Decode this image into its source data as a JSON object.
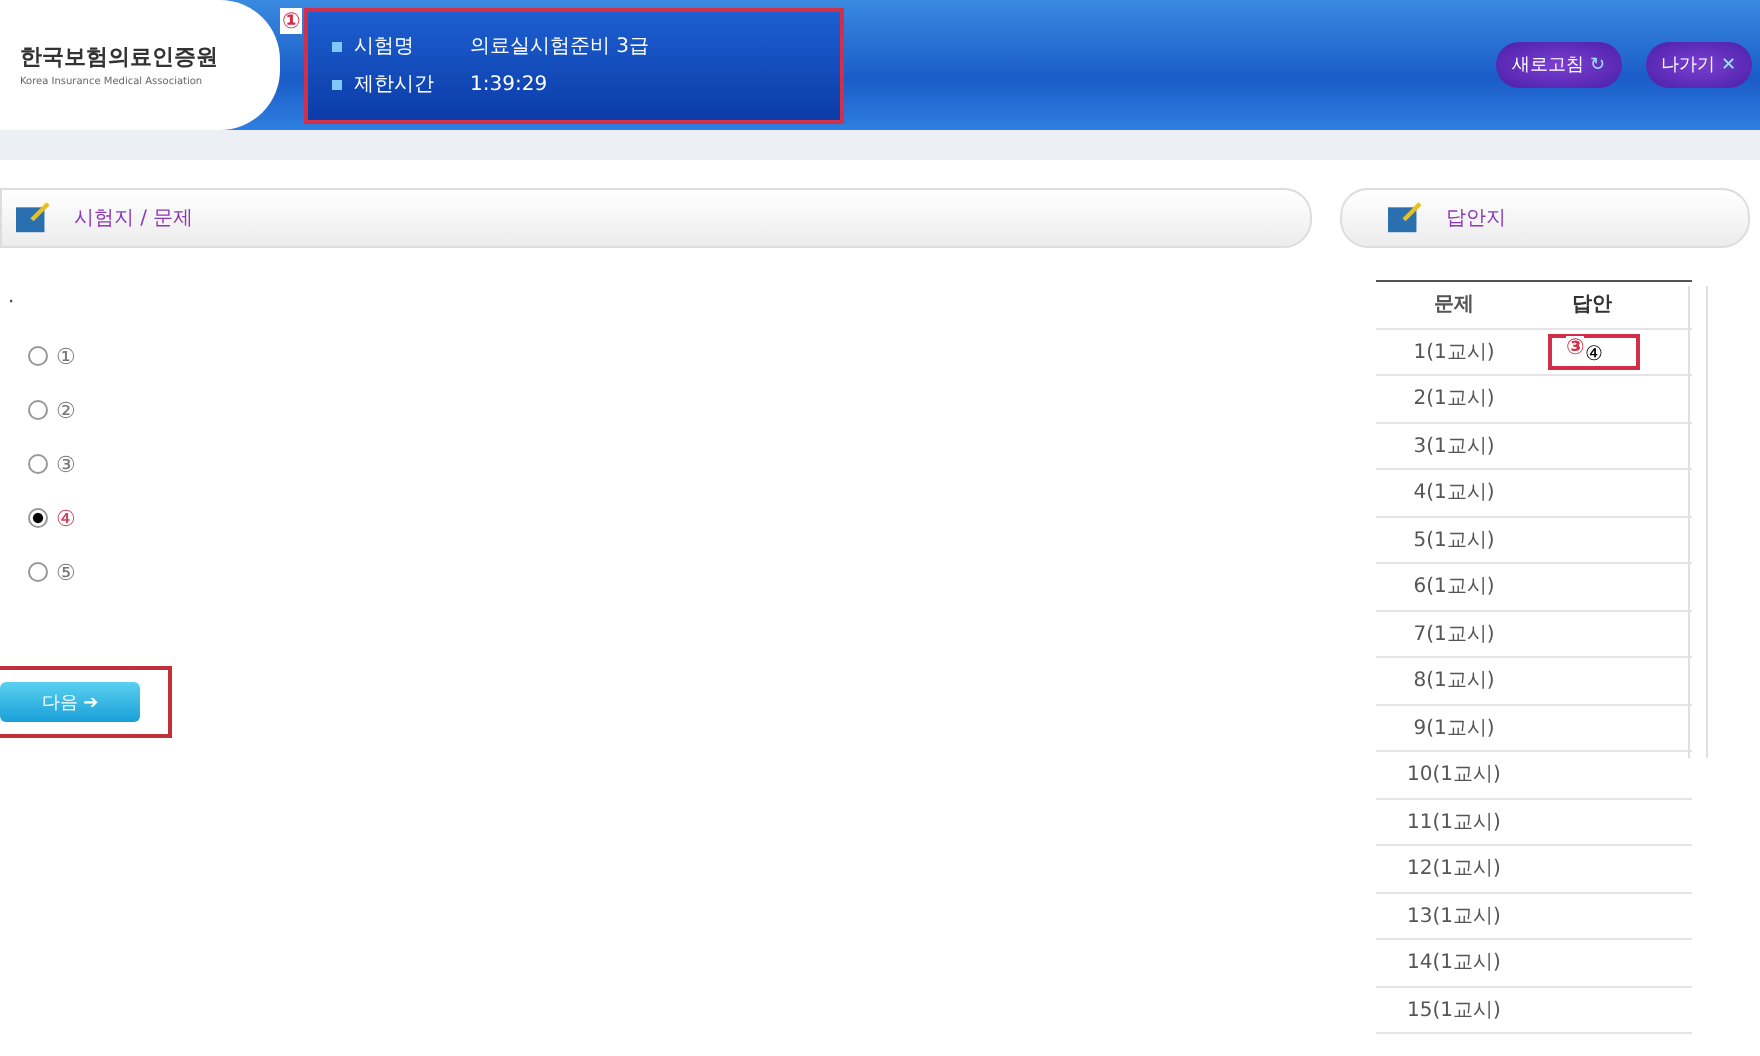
{
  "header": {
    "logo_title": "한국보험의료인증원",
    "logo_subtitle": "Korea Insurance Medical Association",
    "exam_label": "시험명",
    "exam_name": "의료실시험준비 3급",
    "time_label": "제한시간",
    "time_value": "1:39:29",
    "marker": "①",
    "buttons": [
      {
        "label": "새로고침",
        "icon": "↻"
      },
      {
        "label": "나가기",
        "icon": "✕"
      }
    ]
  },
  "question_panel": {
    "title": "시험지 / 문제",
    "question_text": "·",
    "options": [
      {
        "label": "①",
        "selected": false
      },
      {
        "label": "②",
        "selected": false
      },
      {
        "label": "③",
        "selected": false
      },
      {
        "label": "④",
        "selected": true
      },
      {
        "label": "⑤",
        "selected": false
      }
    ],
    "next_button": {
      "label": "다음",
      "icon": "➔"
    }
  },
  "answer_panel": {
    "title": "답안지",
    "marker": "③",
    "columns": [
      "문제",
      "답안"
    ],
    "rows": [
      {
        "question": "1(1교시)",
        "answer": "④"
      },
      {
        "question": "2(1교시)"
      },
      {
        "question": "3(1교시)"
      },
      {
        "question": "4(1교시)"
      },
      {
        "question": "5(1교시)"
      },
      {
        "question": "6(1교시)"
      },
      {
        "question": "7(1교시)"
      },
      {
        "question": "8(1교시)"
      },
      {
        "question": "9(1교시)"
      },
      {
        "question": "10(1교시)"
      },
      {
        "question": "11(1교시)"
      },
      {
        "question": "12(1교시)"
      },
      {
        "question": "13(1교시)"
      },
      {
        "question": "14(1교시)"
      },
      {
        "question": "15(1교시)"
      }
    ]
  }
}
